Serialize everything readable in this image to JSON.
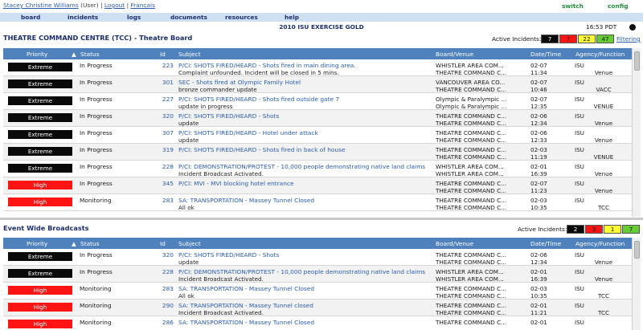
{
  "header": {
    "user_name": "Stacey Christine Williams",
    "user_role": "(User)",
    "sep": "|",
    "logout": "Logout",
    "francais": "Français",
    "switch": "switch",
    "config": "config"
  },
  "nav": [
    "board",
    "incidents",
    "logs",
    "documents",
    "resources",
    "help"
  ],
  "exercise_title": "2010 ISU EXERCISE GOLD",
  "clock": "16:53 PDT",
  "columns": {
    "priority": "Priority",
    "status": "Status",
    "id": "Id",
    "subject": "Subject",
    "venue": "Board/Venue",
    "datetime": "Date/Time",
    "agency": "Agency/Function",
    "sort_arrow": "▲"
  },
  "colors": {
    "extreme": "#0a0a0a",
    "high": "#ff1414",
    "medium": "#ffff33",
    "low": "#66cc33",
    "header": "#4f81bd"
  },
  "tcc": {
    "title": "THEATRE COMMAND CENTRE (TCC) - Theatre Board",
    "active_label": "Active Incidents:",
    "counts": [
      "7",
      "7",
      "22",
      "47"
    ],
    "filtering": "Filtering",
    "rows": [
      {
        "priority": "Extreme",
        "status": "In Progress",
        "id": "223",
        "subject": "P/CI: SHOTS FIRED/HEARD - Shots fired in main dining area.",
        "update": "Complaint unfounded.  Incident will be closed in 5 mins.",
        "venue1": "WHISTLER AREA COM...",
        "venue2": "THEATRE COMMAND C...",
        "date": "02-07",
        "time": "11:34",
        "agency": "ISU",
        "func": "Venue"
      },
      {
        "priority": "Extreme",
        "status": "In Progress",
        "id": "301",
        "subject": "SEC - Shots fired at Olympic Family Hotel",
        "update": "bronze commander update",
        "venue1": "VANCOUVER AREA CO...",
        "venue2": "THEATRE COMMAND C...",
        "date": "02-07",
        "time": "10:46",
        "agency": "ISU",
        "func": "VACC"
      },
      {
        "priority": "Extreme",
        "status": "In Progress",
        "id": "227",
        "subject": "P/CI: SHOTS FIRED/HEARD - Shots fired outside gate 7",
        "update": "update in progress",
        "venue1": "Olympic & Paralympic ...",
        "venue2": "Olympic & Paralympic ...",
        "date": "02-07",
        "time": "12:35",
        "agency": "ISU",
        "func": "VENUE"
      },
      {
        "priority": "Extreme",
        "status": "In Progress",
        "id": "320",
        "subject": "P/CI: SHOTS FIRED/HEARD - Shots",
        "update": "update",
        "venue1": "THEATRE COMMAND C...",
        "venue2": "THEATRE COMMAND C...",
        "date": "02-06",
        "time": "12:34",
        "agency": "ISU",
        "func": "Venue"
      },
      {
        "priority": "Extreme",
        "status": "In Progress",
        "id": "307",
        "subject": "P/CI: SHOTS FIRED/HEARD - Hotel under attack",
        "update": "update",
        "venue1": "THEATRE COMMAND C...",
        "venue2": "THEATRE COMMAND C...",
        "date": "02-06",
        "time": "12:33",
        "agency": "ISU",
        "func": "Venue"
      },
      {
        "priority": "Extreme",
        "status": "In Progress",
        "id": "319",
        "subject": "P/CI: SHOTS FIRED/HEARD - Shots fired in back of house",
        "update": "",
        "venue1": "THEATRE COMMAND C...",
        "venue2": "THEATRE COMMAND C...",
        "date": "02-03",
        "time": "11:19",
        "agency": "ISU",
        "func": "VENUE"
      },
      {
        "priority": "Extreme",
        "status": "In Progress",
        "id": "228",
        "subject": "P/CI: DEMONSTRATION/PROTEST - 10,000 people demonstrating native land claims",
        "update": "Incident Broadcast Activated.",
        "venue1": "WHISTLER AREA COM...",
        "venue2": "WHISTLER AREA COM...",
        "date": "02-01",
        "time": "16:39",
        "agency": "ISU",
        "func": "Venue"
      },
      {
        "priority": "High",
        "status": "In Progress",
        "id": "345",
        "subject": "P/CI: MVI - MVI blocking hotel entrance",
        "update": "",
        "venue1": "THEATRE COMMAND C...",
        "venue2": "THEATRE COMMAND C...",
        "date": "02-07",
        "time": "11:23",
        "agency": "ISU",
        "func": "Venue"
      },
      {
        "priority": "High",
        "status": "Monitoring",
        "id": "283",
        "subject": "SA: TRANSPORTATION - Massey Tunnel Closed",
        "update": "All ok",
        "venue1": "THEATRE COMMAND C...",
        "venue2": "THEATRE COMMAND C...",
        "date": "02-03",
        "time": "10:35",
        "agency": "ISU",
        "func": "TCC"
      }
    ]
  },
  "ewb": {
    "title": "Event Wide Broadcasts",
    "active_label": "Active Incidents:",
    "counts": [
      "2",
      "3",
      "1",
      "7"
    ],
    "rows": [
      {
        "priority": "Extreme",
        "status": "In Progress",
        "id": "320",
        "subject": "P/CI: SHOTS FIRED/HEARD - Shots",
        "update": "update",
        "venue1": "THEATRE COMMAND C...",
        "venue2": "THEATRE COMMAND C...",
        "date": "02-06",
        "time": "12:34",
        "agency": "ISU",
        "func": "Venue"
      },
      {
        "priority": "Extreme",
        "status": "In Progress",
        "id": "228",
        "subject": "P/CI: DEMONSTRATION/PROTEST - 10,000 people demonstrating native land claims",
        "update": "Incident Broadcast Activated.",
        "venue1": "WHISTLER AREA COM...",
        "venue2": "WHISTLER AREA COM...",
        "date": "02-01",
        "time": "16:39",
        "agency": "ISU",
        "func": "Venue"
      },
      {
        "priority": "High",
        "status": "Monitoring",
        "id": "283",
        "subject": "SA: TRANSPORTATION - Massey Tunnel Closed",
        "update": "All ok",
        "venue1": "THEATRE COMMAND C...",
        "venue2": "THEATRE COMMAND C...",
        "date": "02-03",
        "time": "10:35",
        "agency": "ISU",
        "func": "TCC"
      },
      {
        "priority": "High",
        "status": "Monitoring",
        "id": "290",
        "subject": "SA: TRANSPORTATION - Massey Tunnel closed",
        "update": "Incident Broadcast Activated.",
        "venue1": "THEATRE COMMAND C...",
        "venue2": "THEATRE COMMAND C...",
        "date": "02-01",
        "time": "11:21",
        "agency": "ISU",
        "func": "TCC"
      },
      {
        "priority": "High",
        "status": "Monitoring",
        "id": "286",
        "subject": "SA: TRANSPORTATION - Massey Tunnel Closed",
        "update": "",
        "venue1": "THEATRE COMMAND C...",
        "venue2": "",
        "date": "02-01",
        "time": "",
        "agency": "ISU",
        "func": ""
      }
    ]
  }
}
